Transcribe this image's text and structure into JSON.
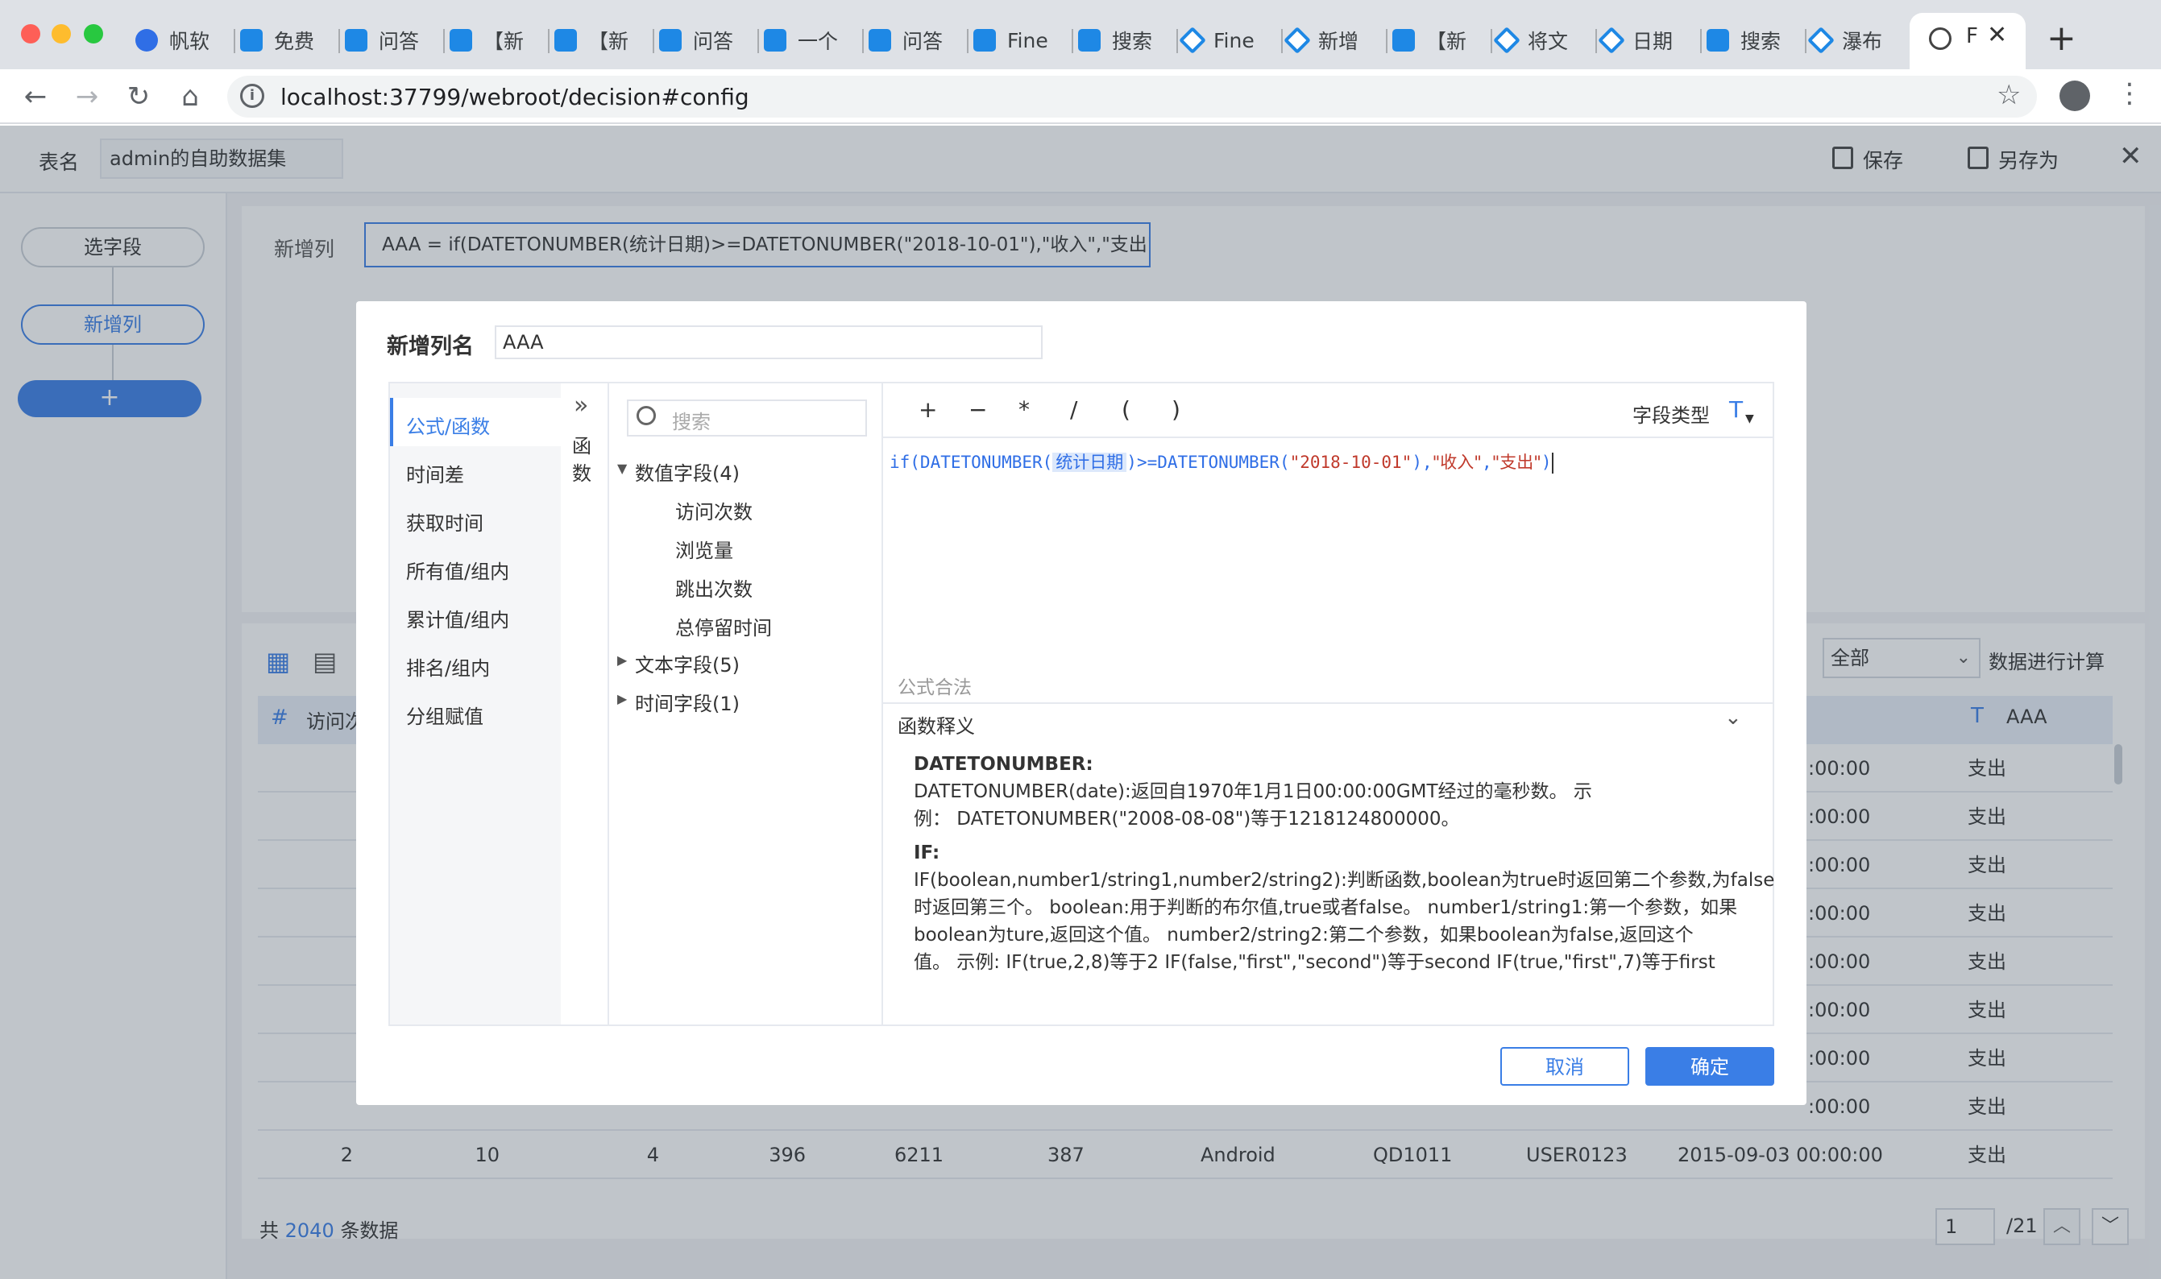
{
  "browser": {
    "tabs": [
      {
        "label": "帆软",
        "icon": "baidu-paw-icon"
      },
      {
        "label": "免费",
        "icon": "finereport-icon"
      },
      {
        "label": "问答",
        "icon": "finereport-icon"
      },
      {
        "label": "【新",
        "icon": "finereport-icon"
      },
      {
        "label": "【新",
        "icon": "finereport-icon"
      },
      {
        "label": "问答",
        "icon": "finereport-icon"
      },
      {
        "label": "一个",
        "icon": "finereport-icon"
      },
      {
        "label": "问答",
        "icon": "finereport-icon"
      },
      {
        "label": "Fine",
        "icon": "finereport-icon"
      },
      {
        "label": "搜索",
        "icon": "finereport-icon"
      },
      {
        "label": "Fine",
        "icon": "fanruan-diamond-icon"
      },
      {
        "label": "新增",
        "icon": "fanruan-diamond-icon"
      },
      {
        "label": "【新",
        "icon": "finereport-icon"
      },
      {
        "label": "将文",
        "icon": "fanruan-diamond-icon"
      },
      {
        "label": "日期",
        "icon": "fanruan-diamond-icon"
      },
      {
        "label": "搜索",
        "icon": "finereport-icon"
      },
      {
        "label": "瀑布",
        "icon": "fanruan-diamond-icon"
      }
    ],
    "active_tab": "F",
    "url": "localhost:37799/webroot/decision#config"
  },
  "header": {
    "table_name_label": "表名",
    "table_name_value": "admin的自助数据集",
    "save_label": "保存",
    "save_as_label": "另存为"
  },
  "steps": {
    "select_fields": "选字段",
    "new_column": "新增列",
    "add": "+"
  },
  "step_panel": {
    "label": "新增列",
    "formula": "AAA = if(DATETONUMBER(统计日期)>=DATETONUMBER(\"2018-10-01\"),\"收入\",\"支出\")"
  },
  "grid": {
    "calc_scope": "全部",
    "calc_label": "数据进行计算",
    "col_first": "访问次",
    "col_last": "AAA",
    "rows": [
      {
        "time": ":00:00",
        "aaa": "支出"
      },
      {
        "time": ":00:00",
        "aaa": "支出"
      },
      {
        "time": ":00:00",
        "aaa": "支出"
      },
      {
        "time": ":00:00",
        "aaa": "支出"
      },
      {
        "time": ":00:00",
        "aaa": "支出"
      },
      {
        "time": ":00:00",
        "aaa": "支出"
      },
      {
        "time": ":00:00",
        "aaa": "支出"
      },
      {
        "time": ":00:00",
        "aaa": "支出"
      }
    ],
    "last_row": {
      "c1": "2",
      "c2": "10",
      "c3": "4",
      "c4": "396",
      "c5": "6211",
      "c6": "387",
      "c7": "Android",
      "c8": "QD1011",
      "c9": "USER0123",
      "c10": "2015-09-03 00:00:00",
      "c11": "支出"
    },
    "total_prefix": "共",
    "total_count": "2040",
    "total_suffix": "条数据",
    "page_current": "1",
    "page_total": "/21"
  },
  "modal": {
    "name_label": "新增列名",
    "name_value": "AAA",
    "categories": [
      "公式/函数",
      "时间差",
      "获取时间",
      "所有值/组内",
      "累计值/组内",
      "排名/组内",
      "分组赋值"
    ],
    "func_tab": [
      "函",
      "数"
    ],
    "search_placeholder": "搜索",
    "tree": {
      "numeric_group": "数值字段(4)",
      "numeric_fields": [
        "访问次数",
        "浏览量",
        "跳出次数",
        "总停留时间"
      ],
      "text_group": "文本字段(5)",
      "time_group": "时间字段(1)"
    },
    "operators": [
      "+",
      "−",
      "*",
      "/",
      "(",
      ")"
    ],
    "field_type_label": "字段类型",
    "field_type_value": "T",
    "formula": {
      "t1": "if(DATETONUMBER(",
      "field": "统计日期",
      "t2": ")>=DATETONUMBER(",
      "s1": "\"2018-10-01\"",
      "t3": "),",
      "s2": "\"收入\"",
      "t4": ",",
      "s3": "\"支出\"",
      "t5": ")"
    },
    "status": "公式合法",
    "explain_title": "函数释义",
    "explain": {
      "f1_name": "DATETONUMBER:",
      "f1_l1": "DATETONUMBER(date):返回自1970年1月1日00:00:00GMT经过的毫秒数。 示",
      "f1_l2": "例：  DATETONUMBER(\"2008-08-08\")等于1218124800000。",
      "f2_name": "IF:",
      "f2_l1": "IF(boolean,number1/string1,number2/string2):判断函数,boolean为true时返回第二个参数,为false",
      "f2_l2": "时返回第三个。 boolean:用于判断的布尔值,true或者false。 number1/string1:第一个参数，如果",
      "f2_l3": "boolean为ture,返回这个值。 number2/string2:第二个参数，如果boolean为false,返回这个",
      "f2_l4": "值。 示例: IF(true,2,8)等于2 IF(false,\"first\",\"second\")等于second IF(true,\"first\",7)等于first"
    },
    "cancel_label": "取消",
    "confirm_label": "确定"
  },
  "colors": {
    "accent": "#3a7ee6",
    "formula_func": "#2f6ee6",
    "formula_string": "#c0392b",
    "field_highlight": "#dce8fb"
  }
}
